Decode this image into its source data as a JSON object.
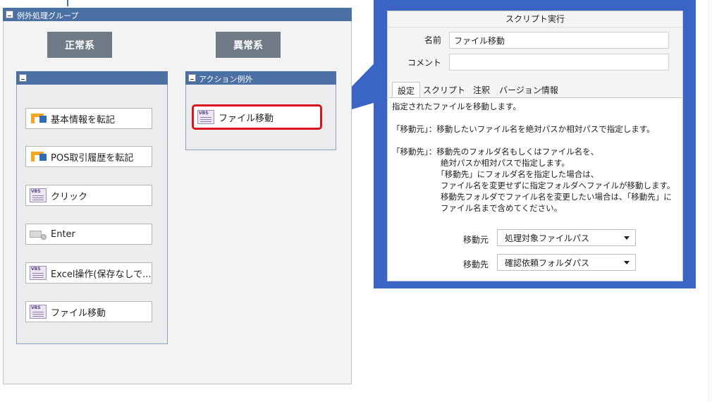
{
  "group": {
    "title": "例外処理グループ"
  },
  "branches": {
    "normal": "正常系",
    "error": "異常系"
  },
  "action_exception": {
    "title": "アクション例外",
    "node": "ファイル移動"
  },
  "nodes": [
    {
      "label": "基本情報を転記",
      "icon": "transcribe-icon"
    },
    {
      "label": "POS取引履歴を転記",
      "icon": "transcribe-icon"
    },
    {
      "label": "クリック",
      "icon": "vbs-script-icon"
    },
    {
      "label": "Enter",
      "icon": "keyboard-icon"
    },
    {
      "label": "Excel操作(保存なしで...",
      "icon": "vbs-script-icon"
    },
    {
      "label": "ファイル移動",
      "icon": "vbs-script-icon"
    }
  ],
  "dialog": {
    "title": "スクリプト実行",
    "name_label": "名前",
    "name_value": "ファイル移動",
    "comment_label": "コメント",
    "comment_value": "",
    "tabs": [
      "設定",
      "スクリプト",
      "注釈",
      "バージョン情報"
    ],
    "description": [
      "指定されたファイルを移動します。",
      "",
      "「移動元」：移動したいファイル名を絶対パスか相対パスで指定します。",
      "",
      "「移動先」：移動先のフォルダ名もしくはファイル名を、",
      "　　　　　　絶対パスか相対パスで指定します。",
      "　　　　　　「移動先」にフォルダ名を指定した場合は、",
      "　　　　　　ファイル名を変更せずに指定フォルダへファイルが移動します。",
      "　　　　　　移動先フォルダでファイル名を変更したい場合は、「移動先」に",
      "　　　　　　ファイル名まで含めてください。"
    ],
    "source_label": "移動元",
    "source_value": "処理対象ファイルパス",
    "dest_label": "移動先",
    "dest_value": "確認依頼フォルダパス"
  },
  "colors": {
    "accent_blue": "#3a65c4",
    "header_blue": "#4a70a4",
    "highlight_red": "#d9141e",
    "branch_gray": "#6e7b86"
  }
}
